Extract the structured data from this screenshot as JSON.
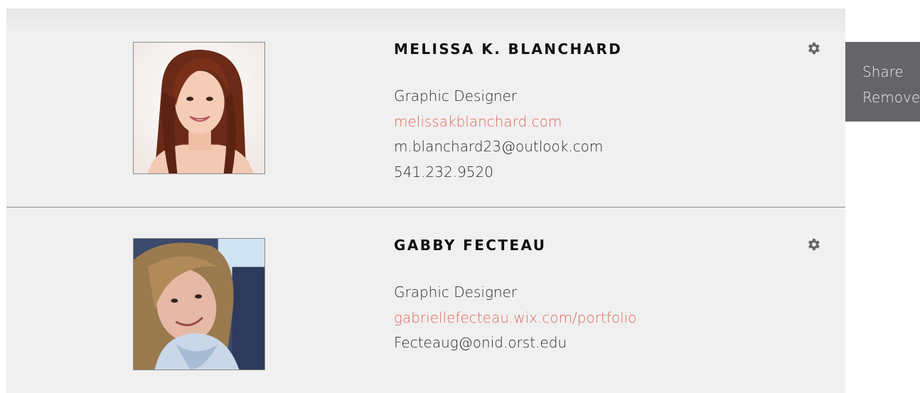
{
  "contacts": [
    {
      "name": "MELISSA K. BLANCHARD",
      "title": "Graphic Designer",
      "website": "melissakblanchard.com",
      "email": "m.blanchard23@outlook.com",
      "phone": "541.232.9520",
      "settings_icon": "gear-icon"
    },
    {
      "name": "GABBY FECTEAU",
      "title": "Graphic Designer",
      "website": "gabriellefecteau.wix.com/portfolio",
      "email": "Fecteaug@onid.orst.edu",
      "settings_icon": "gear-icon"
    }
  ],
  "context_menu": {
    "items": [
      {
        "label": "Share"
      },
      {
        "label": "Remove"
      }
    ]
  },
  "colors": {
    "card_background": "#f0f0f0",
    "link": "#e0685b",
    "menu_background": "#656569",
    "menu_text": "#ececec",
    "divider": "#8f8f8f"
  }
}
